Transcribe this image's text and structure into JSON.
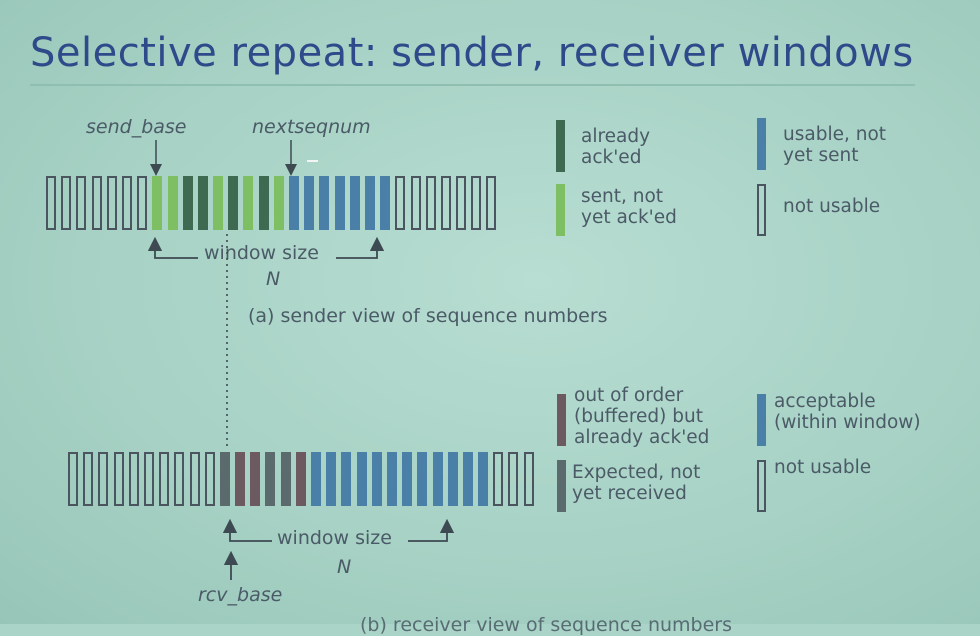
{
  "title": "Selective repeat: sender, receiver windows",
  "sender": {
    "send_base_label": "send_base",
    "nextseqnum_label": "nextseqnum",
    "window_label": "window size",
    "n_label": "N",
    "caption": "(a) sender view of sequence numbers",
    "cells": [
      "empty",
      "empty",
      "empty",
      "empty",
      "empty",
      "empty",
      "empty",
      "sent",
      "sent",
      "acked",
      "acked",
      "sent",
      "acked",
      "sent",
      "acked",
      "sent",
      "usable",
      "usable",
      "usable",
      "usable",
      "usable",
      "usable",
      "usable",
      "empty",
      "empty",
      "empty",
      "empty",
      "empty",
      "empty",
      "empty"
    ]
  },
  "receiver": {
    "rcv_base_label": "rcv_base",
    "window_label": "window size",
    "n_label": "N",
    "caption": "(b) receiver view of sequence numbers",
    "cells": [
      "empty",
      "empty",
      "empty",
      "empty",
      "empty",
      "empty",
      "empty",
      "empty",
      "empty",
      "empty",
      "expected",
      "buffered",
      "buffered",
      "expected",
      "expected",
      "buffered",
      "acceptable",
      "acceptable",
      "acceptable",
      "acceptable",
      "acceptable",
      "acceptable",
      "acceptable",
      "acceptable",
      "acceptable",
      "acceptable",
      "acceptable",
      "acceptable",
      "empty",
      "empty",
      "empty"
    ]
  },
  "legend_sender": {
    "already_acked": "already\nack'ed",
    "usable_not_sent": "usable, not\nyet sent",
    "sent_not_acked": "sent, not\nyet ack'ed",
    "not_usable": "not usable"
  },
  "legend_receiver": {
    "out_of_order": "out of order\n(buffered) but\nalready ack'ed",
    "acceptable": "acceptable\n(within window)",
    "expected": "Expected, not\nyet received",
    "not_usable": "not usable"
  },
  "colors": {
    "acked": "#3f6a52",
    "sent": "#7dbf62",
    "usable": "#4a7fa8",
    "buffered": "#6c5a60",
    "expected": "#5b6a6c",
    "acceptable": "#4a7fa8",
    "empty_border": "#4a5560",
    "title": "#2f4a8a"
  }
}
